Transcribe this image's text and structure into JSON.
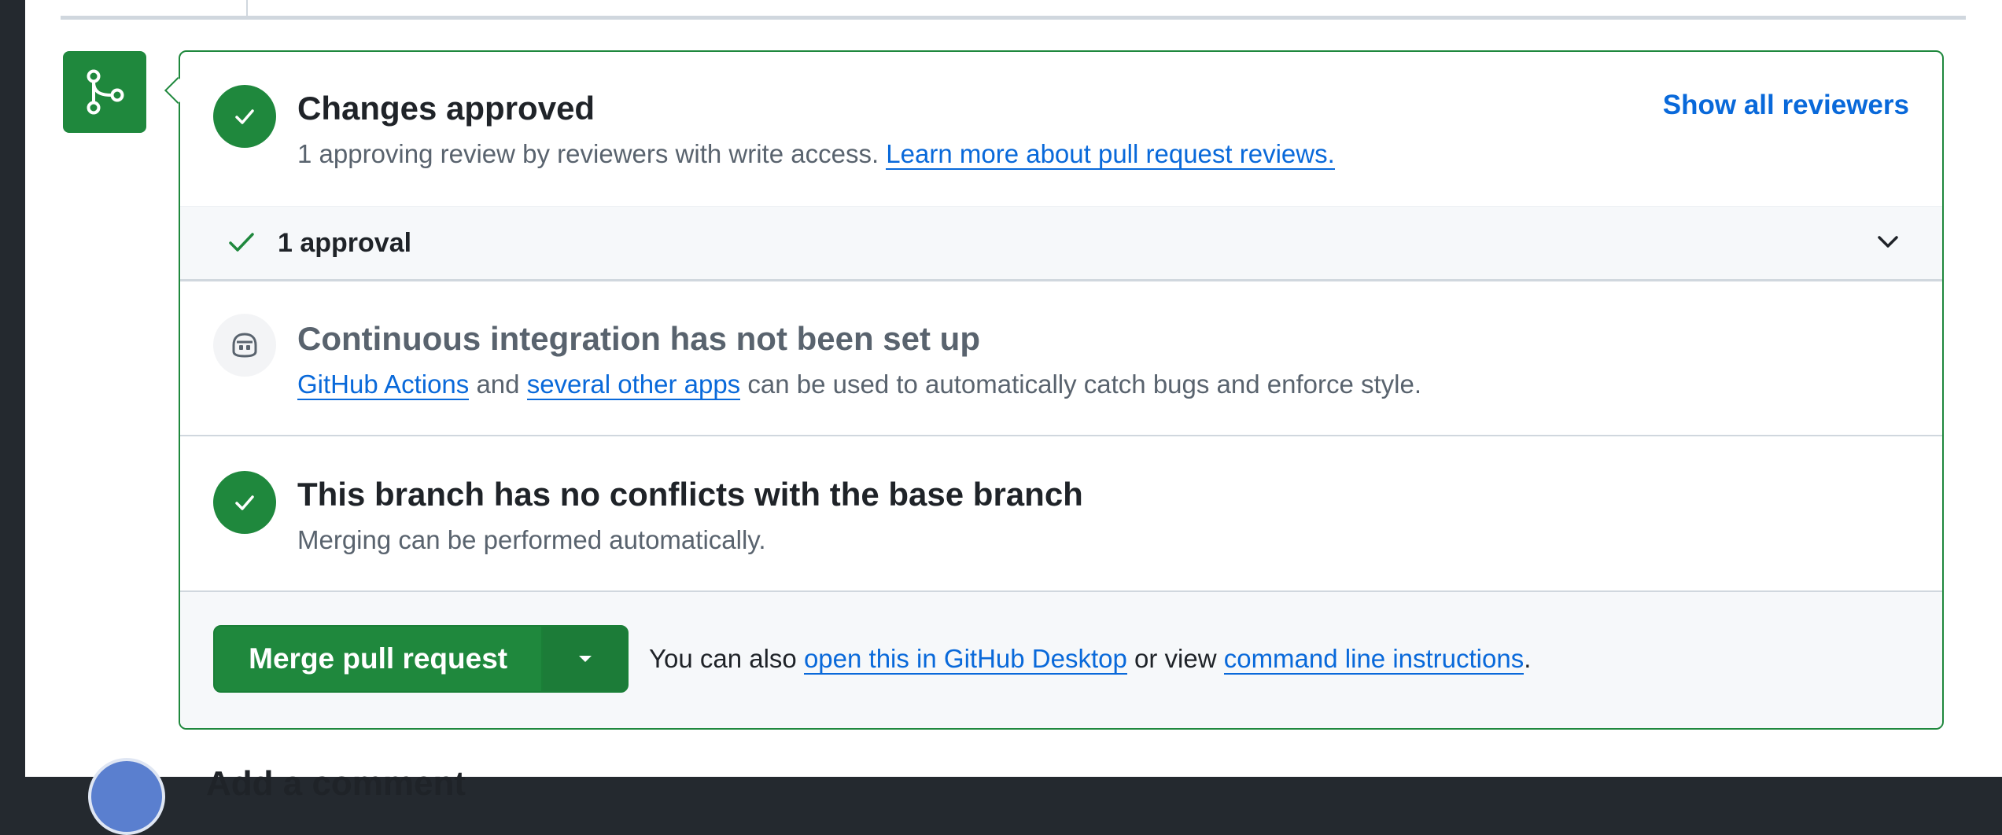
{
  "review": {
    "title": "Changes approved",
    "description": "1 approving review by reviewers with write access.",
    "learn_more_link": "Learn more about pull request reviews.",
    "show_all_reviewers": "Show all reviewers"
  },
  "approval": {
    "label": "1 approval"
  },
  "ci": {
    "title": "Continuous integration has not been set up",
    "actions_link": "GitHub Actions",
    "and_text": "and",
    "other_apps_link": "several other apps",
    "tail_text": "can be used to automatically catch bugs and enforce style."
  },
  "conflicts": {
    "title": "This branch has no conflicts with the base branch",
    "description": "Merging can be performed automatically."
  },
  "merge": {
    "button_label": "Merge pull request",
    "prefix_text": "You can also",
    "desktop_link": "open this in GitHub Desktop",
    "middle_text": "or view",
    "cli_link": "command line instructions",
    "suffix_text": "."
  },
  "comment": {
    "heading": "Add a comment"
  },
  "colors": {
    "success": "#1f883d",
    "link": "#0969da",
    "muted": "#59636e",
    "canvas_subtle": "#f6f8fa"
  },
  "icons": [
    "git-merge-icon",
    "check-circle-icon",
    "copilot-icon",
    "check-icon",
    "chevron-down-icon",
    "triangle-down-icon"
  ]
}
